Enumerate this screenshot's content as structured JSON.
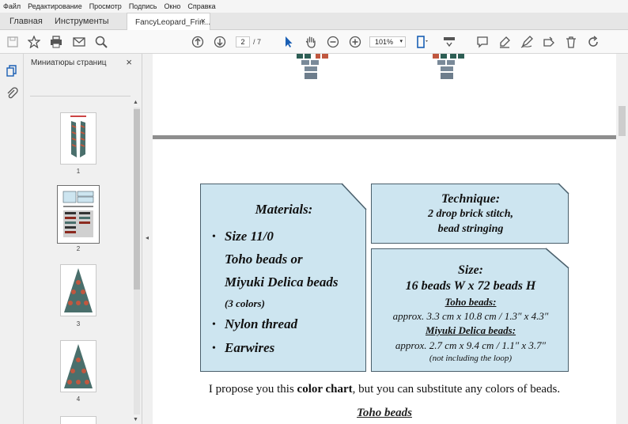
{
  "menu": [
    "Файл",
    "Редактирование",
    "Просмотр",
    "Подпись",
    "Окно",
    "Справка"
  ],
  "tabs": {
    "home": "Главная",
    "tools": "Инструменты",
    "document": "FancyLeopard_Frin...",
    "close_glyph": "×"
  },
  "toolbar": {
    "current_page": "2",
    "total_pages": "/ 7",
    "zoom": "101%",
    "zoom_caret": "▾",
    "icons": [
      "save-icon",
      "star-icon",
      "print-icon",
      "mail-icon",
      "search-icon",
      "page-up-icon",
      "page-down-icon",
      "select-arrow-icon",
      "hand-icon",
      "zoom-out-icon",
      "zoom-in-icon",
      "fit-page-icon",
      "scroll-mode-icon",
      "comment-icon",
      "highlight-icon",
      "sign-icon",
      "fill-icon",
      "delete-icon",
      "rotate-icon"
    ]
  },
  "sidebar": {
    "title": "Миниатюры страниц",
    "close_glyph": "×",
    "thumbnails": [
      {
        "page": "1",
        "selected": false
      },
      {
        "page": "2",
        "selected": true
      },
      {
        "page": "3",
        "selected": false
      },
      {
        "page": "4",
        "selected": false
      }
    ],
    "collapse_glyph": "◂"
  },
  "document": {
    "materials": {
      "title": "Materials:",
      "bullets": [
        "•",
        "•",
        "•"
      ],
      "line1": "Size 11/0",
      "line2": "Toho beads or",
      "line3": "Miyuki Delica beads",
      "line4": "(3 colors)",
      "line5": "Nylon thread",
      "line6": "Earwires"
    },
    "technique": {
      "title": "Technique:",
      "line1": "2 drop brick stitch,",
      "line2": "bead stringing"
    },
    "size": {
      "title": "Size:",
      "beads": "16 beads W x 72 beads H",
      "toho_label": "Toho beads:",
      "toho_dims": "approx. 3.3 cm x 10.8 cm / 1.3″ x 4.3″",
      "miyuki_label": "Miyuki Delica beads:",
      "miyuki_dims": "approx. 2.7 cm x 9.4 cm / 1.1″ x 3.7″",
      "note": "(not including the loop)"
    },
    "proposal_before": "I propose you this ",
    "proposal_bold": "color chart",
    "proposal_after": ", but you can substitute any colors of beads.",
    "toho_heading": "Toho beads"
  }
}
